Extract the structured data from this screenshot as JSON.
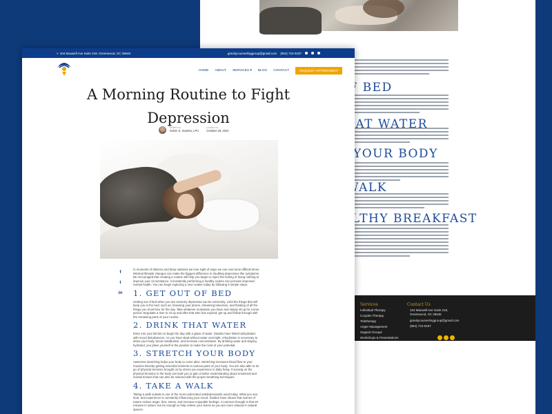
{
  "colors": {
    "background": "#0e3a7a",
    "brand": "#0d3d8a",
    "accent": "#f0a400",
    "heading": "#1b4a9a"
  },
  "topbar": {
    "address": "104 Maxwell Ave Suite 219, Greenwood, SC 29646",
    "email": "gravitycounselinggroup@gmail.com",
    "phone": "(864) 724-9187"
  },
  "nav": {
    "items": [
      "HOME",
      "ABOUT",
      "SERVICES ▾",
      "BLOG",
      "CONTACT"
    ],
    "cta": "REQUEST APPOINTMENT"
  },
  "article": {
    "title_line1": "A Morning Routine to Fight",
    "title_line2": "Depression",
    "written_by_label": "written by",
    "author": "Kelvin K. Searles, LPC",
    "posted_on_label": "posted on",
    "date": "October 28, 2021",
    "intro": "In moments of distress and deep sadness we lose sight of ways we can overcome difficult times. Minimal lifestyle changes can make the biggest difference in doubling depressive like symptoms. Be encouraged that creating a routine will help you begin to reject the feeling of doing nothing to improve your circumstance. Consistently performing a healthy routine can promote improved mental health. You can begin exploring a new routine today by following 5 simple steps:",
    "sections": [
      {
        "heading": "1. GET OUT OF BED",
        "text": "Getting out of bed when you are severely depressed can be extremely. Limit the things that will keep you in the bed; such as, browsing your phone, streaming television, and thinking of all the things you must face for the day. Take whatever motivation you have and simply sit up for a time period. Negotiate a time to sit up and after that time has expired, get up and follow through with the remaining parts of your routine."
      },
      {
        "heading": "2. DRINK THAT WATER",
        "text": "Enter into your kitchen to begin the day with a glass of water. Studies have linked dehydration with mood disturbances. As you have slept without water overnight, rehydration is necessary to detox your body, boost metabolism, and increase concentration. By drinking water and staying hydrated, you place yourself in the position to make the most of your potential."
      },
      {
        "heading": "3. STRETCH YOUR BODY",
        "text": "Awesome stretching helps your body to come alive. Stretching increases blood flow to your muscles thereby getting essential nutrients to various parts of your body. You are also able to let go of physical tensions brought on by stress you experience in daily living. Focusing on the physical tensions in the body can lead you to gain a better understanding about emotional and mental tension that can also be relieved with the proper breathing techniques."
      },
      {
        "heading": "4. TAKE A WALK",
        "text": "Taking a walk outside is one of the most underrated antidepressants used today. What you see, hear, and experience is constantly influencing your mood. Studies have shown that scenes of nature reduce anger, fear, stress, and increase enjoyable feelings. A common thought is that 20 minutes in nature can be enough to help relieve your stress as you are more relaxed in natural spaces."
      }
    ]
  },
  "share": [
    "f",
    "t",
    "in"
  ],
  "back_page": {
    "headings": [
      "OF BED",
      "HAT WATER",
      "YOUR BODY",
      "WALK",
      "ALTHY BREAKFAST"
    ],
    "footer": {
      "services_title": "Services",
      "services": [
        "Individual Therapy",
        "Couples Therapy",
        "Teletherapy",
        "Anger Management",
        "Support Groups",
        "Workshops & Presentations"
      ],
      "contact_title": "Contact Us",
      "contact": [
        "104 Maxwell Ave Suite 219,",
        "Greenwood, SC 29646",
        "gravitycounselinggroup@gmail.com",
        "(864) 724-9187"
      ]
    }
  }
}
